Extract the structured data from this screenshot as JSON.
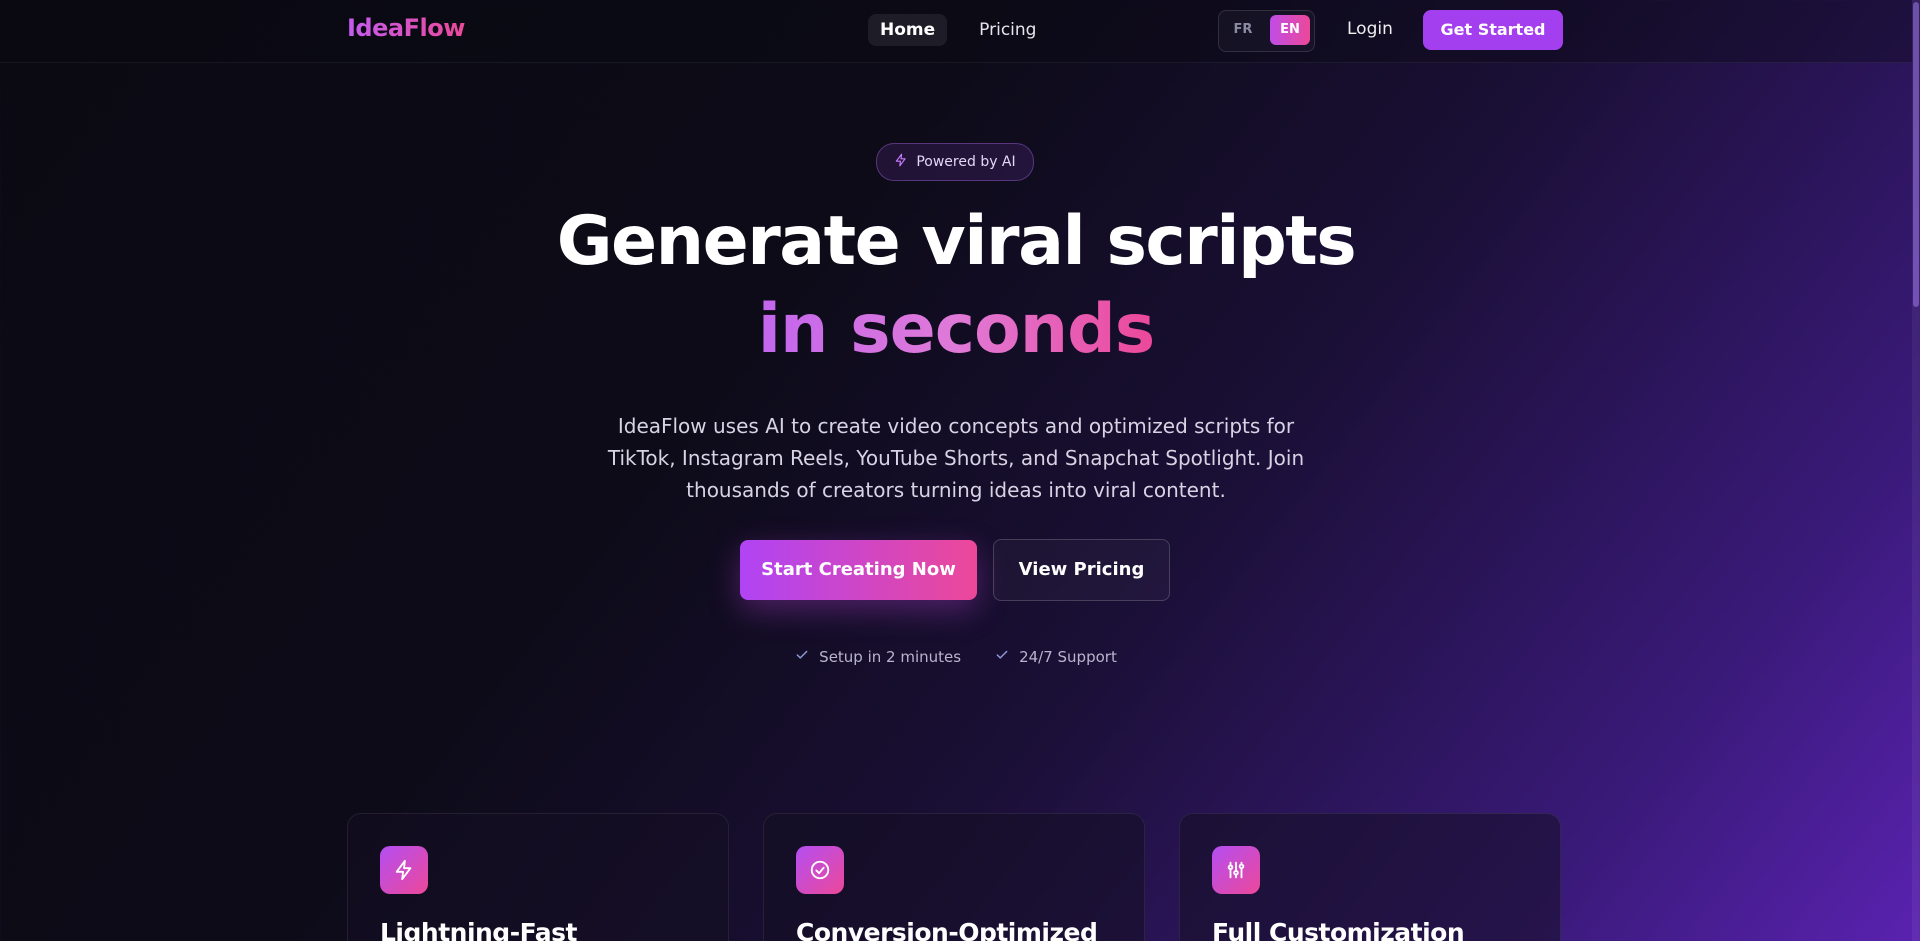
{
  "header": {
    "logo": "IdeaFlow",
    "nav": [
      {
        "label": "Home",
        "active": true
      },
      {
        "label": "Pricing",
        "active": false
      }
    ],
    "languages": [
      {
        "label": "FR",
        "selected": false
      },
      {
        "label": "EN",
        "selected": true
      }
    ],
    "login": "Login",
    "get_started": "Get Started"
  },
  "hero": {
    "badge": "Powered by AI",
    "headline": "Generate viral scripts",
    "headline_accent": "in seconds",
    "description": "IdeaFlow uses AI to create video concepts and optimized scripts for TikTok, Instagram Reels, YouTube Shorts, and Snapchat Spotlight. Join thousands of creators turning ideas into viral content.",
    "primary_cta": "Start Creating Now",
    "secondary_cta": "View Pricing",
    "checks": [
      "Setup in 2 minutes",
      "24/7 Support"
    ]
  },
  "features": [
    {
      "icon": "lightning-icon",
      "title": "Lightning-Fast"
    },
    {
      "icon": "check-circle-icon",
      "title": "Conversion-Optimized"
    },
    {
      "icon": "sliders-icon",
      "title": "Full Customization"
    }
  ],
  "colors": {
    "accent_purple": "#a43ff0",
    "accent_pink": "#ec4899",
    "background_dark": "#0b0a12"
  }
}
